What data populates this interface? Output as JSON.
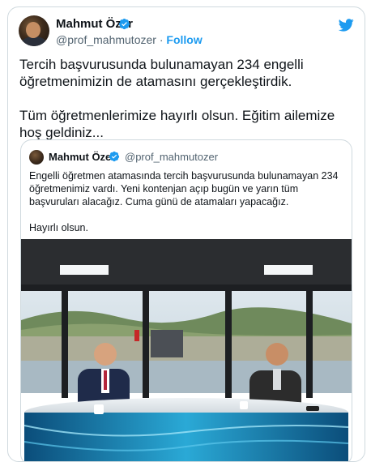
{
  "tweet": {
    "author_name": "Mahmut Özer",
    "handle": "@prof_mahmutozer",
    "separator": " · ",
    "follow_label": "Follow",
    "paragraphs": [
      "Tercih başvurusunda bulunamayan 234 engelli öğretmenimizin de atamasını gerçekleştirdik.",
      "Tüm öğretmenlerimize hayırlı olsun. Eğitim ailemize hoş geldiniz..."
    ]
  },
  "quoted_tweet": {
    "author_name": "Mahmut Özer",
    "handle": "@prof_mahmutozer",
    "paragraphs": [
      "Engelli öğretmen atamasında tercih başvurusunda bulunamayan 234 öğretmenimiz vardı. Yeni kontenjan açıp bugün ve yarın tüm başvuruları alacağız. Cuma günü de atamaları yapacağız.",
      "Hayırlı olsun."
    ]
  },
  "icons": {
    "verified": "verified-badge-icon",
    "brand": "twitter-bird-icon"
  },
  "colors": {
    "accent": "#1d9bf0",
    "text": "#0f1419",
    "muted": "#536471",
    "border": "#cfd9de"
  }
}
